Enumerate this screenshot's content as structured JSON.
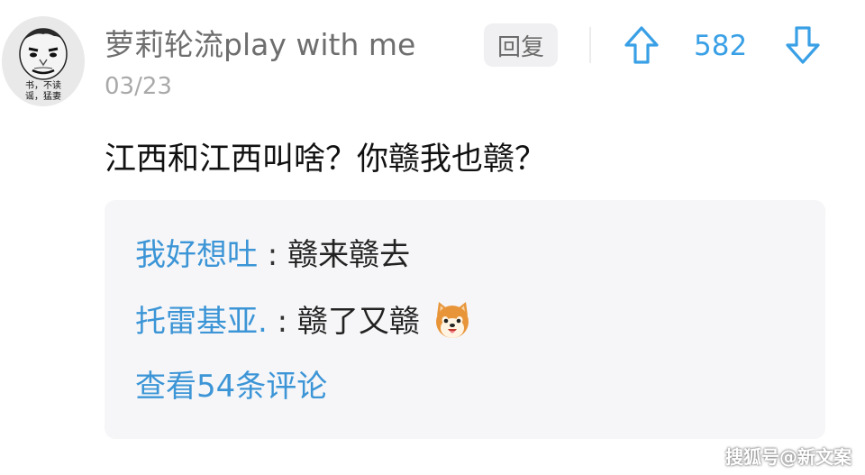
{
  "comment": {
    "username": "萝莉轮流play with me",
    "date": "03/23",
    "avatar_caption": "书，不读 谣，猛妻",
    "text": "江西和江西叫啥？你赣我也赣？",
    "reply_label": "回复",
    "vote_count": "582",
    "icons": {
      "upvote": "arrow-up-icon",
      "downvote": "arrow-down-icon"
    }
  },
  "replies": [
    {
      "author": "我好想吐",
      "separator": " : ",
      "text": "赣来赣去"
    },
    {
      "author": "托雷基亚.",
      "separator": " : ",
      "text": "赣了又赣",
      "emoji": "shiba-dog-emoji"
    }
  ],
  "view_more": "查看54条评论",
  "watermark": "搜狐号@新文案",
  "colors": {
    "accent_blue": "#3c95d6",
    "vote_blue": "#3aa0e6",
    "username_gray": "#6e6e6e",
    "date_gray": "#a9a9a9",
    "reply_box_bg": "#f6f6f8"
  }
}
